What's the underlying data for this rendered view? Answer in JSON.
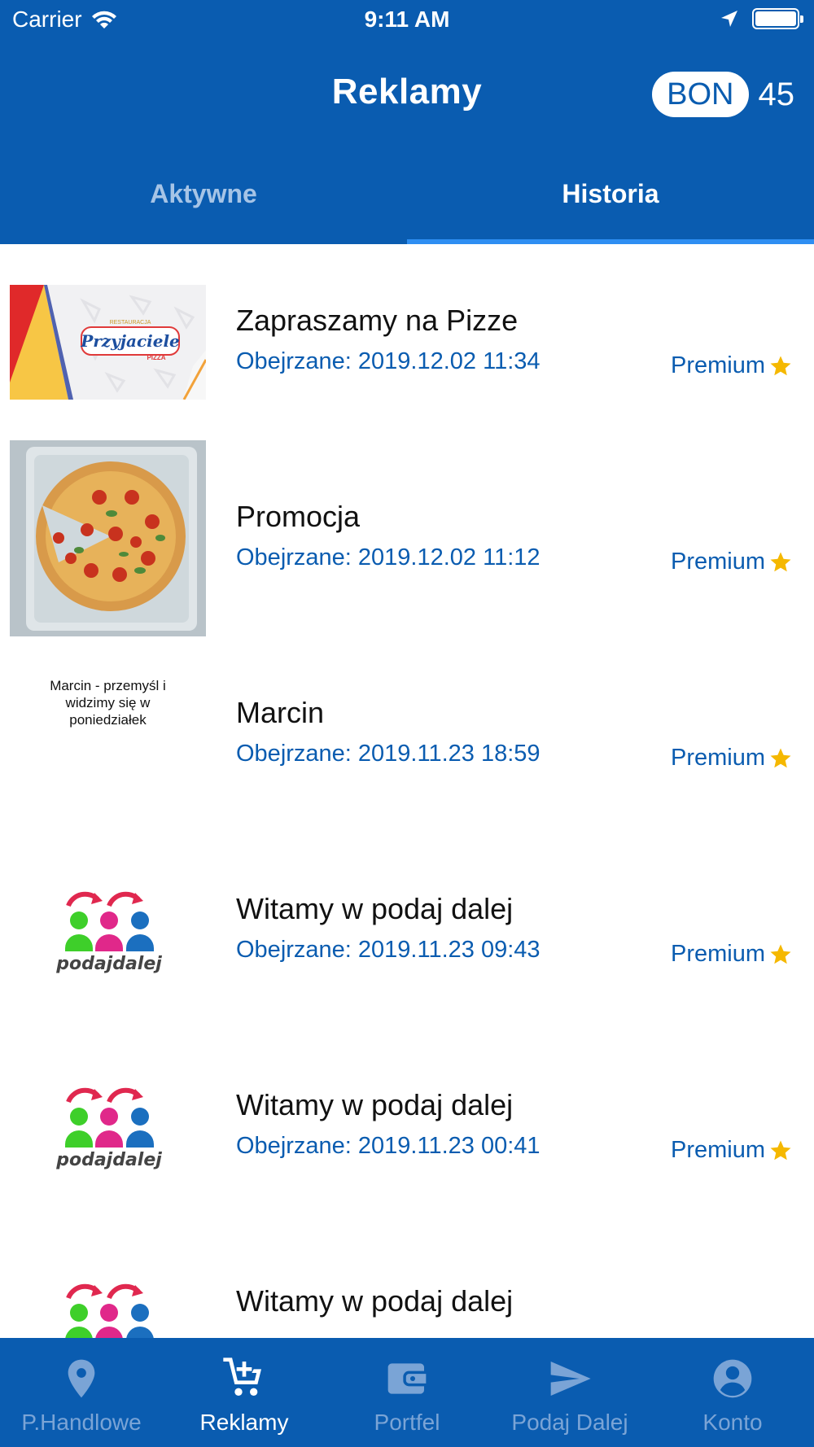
{
  "status_bar": {
    "carrier": "Carrier",
    "time": "9:11 AM"
  },
  "header": {
    "title": "Reklamy",
    "bon_label": "BON",
    "bon_count": "45"
  },
  "tabs": [
    {
      "label": "Aktywne",
      "active": false
    },
    {
      "label": "Historia",
      "active": true
    }
  ],
  "items": [
    {
      "title": "Zapraszamy na Pizze",
      "date": "Obejrzane: 2019.12.02 11:34",
      "badge": "Premium",
      "thumbnail": "przyjaciele-pizza-logo"
    },
    {
      "title": "Promocja",
      "date": "Obejrzane: 2019.12.02 11:12",
      "badge": "Premium",
      "thumbnail": "pizza-photo"
    },
    {
      "title": "Marcin",
      "date": "Obejrzane: 2019.11.23 18:59",
      "badge": "Premium",
      "thumbnail_text": "Marcin - przemyśl i widzimy się w poniedziałek"
    },
    {
      "title": "Witamy w podaj dalej",
      "date": "Obejrzane: 2019.11.23 09:43",
      "badge": "Premium",
      "thumbnail": "podaj-dalej-logo"
    },
    {
      "title": "Witamy w podaj dalej",
      "date": "Obejrzane: 2019.11.23 00:41",
      "badge": "Premium",
      "thumbnail": "podaj-dalej-logo"
    },
    {
      "title": "Witamy w podaj dalej",
      "date": "",
      "badge": "",
      "thumbnail": "podaj-dalej-logo"
    }
  ],
  "logos": {
    "przyjaciele": "Przyjaciele",
    "pizza": "PIZZA",
    "podaj_dalej": "podajdalej"
  },
  "tabbar": [
    {
      "label": "P.Handlowe",
      "icon": "location-pin-icon",
      "active": false
    },
    {
      "label": "Reklamy",
      "icon": "cart-add-icon",
      "active": true
    },
    {
      "label": "Portfel",
      "icon": "wallet-icon",
      "active": false
    },
    {
      "label": "Podaj Dalej",
      "icon": "send-icon",
      "active": false
    },
    {
      "label": "Konto",
      "icon": "account-icon",
      "active": false
    }
  ],
  "colors": {
    "primary": "#0a5cb0",
    "accent_underline": "#2e8ef2",
    "star": "#f5b800"
  }
}
